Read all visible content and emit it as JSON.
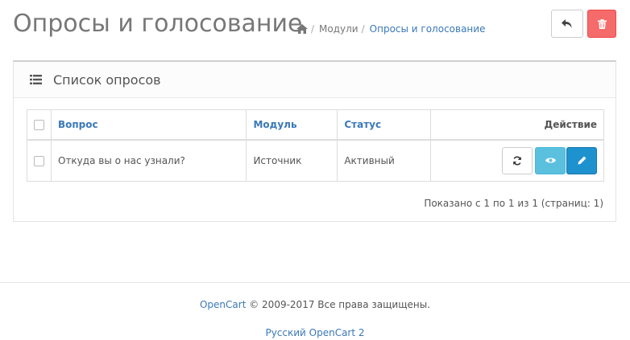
{
  "page": {
    "title": "Опросы и голосование"
  },
  "breadcrumb": {
    "home_icon": "home-icon",
    "separator": "/",
    "items": [
      "Модули",
      "Опросы и голосование"
    ]
  },
  "toolbar": {
    "back_icon": "reply-icon",
    "delete_icon": "trash-icon",
    "delete_color": "#f56b6b"
  },
  "panel": {
    "title": "Список опросов",
    "icon": "list-icon"
  },
  "table": {
    "headers": {
      "question": "Вопрос",
      "module": "Модуль",
      "status": "Статус",
      "action": "Действие"
    },
    "rows": [
      {
        "question": "Откуда вы о нас узнали?",
        "module": "Источник",
        "status": "Активный",
        "actions": [
          "refresh-icon",
          "eye-icon",
          "pencil-icon"
        ]
      }
    ]
  },
  "pagination": {
    "text": "Показано с 1 по 1 из 1 (страниц: 1)"
  },
  "footer": {
    "brand_link": "OpenCart",
    "copyright": "© 2009-2017 Все права защищены.",
    "version_link": "Русский OpenCart 2"
  },
  "colors": {
    "link": "#3b79b8",
    "view_button": "#5bc0de",
    "edit_button": "#1e91cf"
  }
}
